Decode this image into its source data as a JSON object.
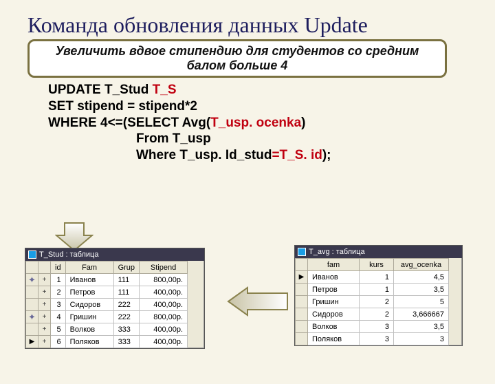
{
  "title": "Команда обновления данных Update",
  "callout": "Увеличить вдвое стипендию для студентов со средним балом больше 4",
  "sql": {
    "l1a": "UPDATE",
    "l1b": " T_Stud ",
    "l1c": " T_S",
    "l2a": "SET",
    "l2b": " stipend = stipend*2",
    "l3a": "WHERE",
    "l3b": " 4<=(",
    "l3c": "SELECT",
    "l3d": "  Avg(",
    "l3e": "T_usp. ocenka",
    "l3f": ")",
    "l4a": "From",
    "l4b": " T_usp",
    "l5a": "Where",
    "l5b": "  T_usp. Id_stud",
    "l5c": "=",
    "l5d": "T_S. id",
    "l5e": ");"
  },
  "left_table": {
    "caption": "T_Stud : таблица",
    "cols": [
      "id",
      "Fam",
      "Grup",
      "Stipend"
    ],
    "rows": [
      {
        "mark": "star",
        "id": "1",
        "fam": "Иванов",
        "grup": "111",
        "st": "800,00р."
      },
      {
        "mark": "plus",
        "id": "2",
        "fam": "Петров",
        "grup": "111",
        "st": "400,00р."
      },
      {
        "mark": "plus",
        "id": "3",
        "fam": "Сидоров",
        "grup": "222",
        "st": "400,00р."
      },
      {
        "mark": "star",
        "id": "4",
        "fam": "Гришин",
        "grup": "222",
        "st": "800,00р."
      },
      {
        "mark": "plus",
        "id": "5",
        "fam": "Волков",
        "grup": "333",
        "st": "400,00р."
      },
      {
        "mark": "cursor",
        "id": "6",
        "fam": "Поляков",
        "grup": "333",
        "st": "400,00р."
      }
    ]
  },
  "right_table": {
    "caption": "T_avg : таблица",
    "cols": [
      "fam",
      "kurs",
      "avg_ocenka"
    ],
    "rows": [
      {
        "mark": "cursor",
        "fam": "Иванов",
        "kurs": "1",
        "avg": "4,5"
      },
      {
        "mark": "",
        "fam": "Петров",
        "kurs": "1",
        "avg": "3,5"
      },
      {
        "mark": "",
        "fam": "Гришин",
        "kurs": "2",
        "avg": "5"
      },
      {
        "mark": "",
        "fam": "Сидоров",
        "kurs": "2",
        "avg": "3,666667"
      },
      {
        "mark": "",
        "fam": "Волков",
        "kurs": "3",
        "avg": "3,5"
      },
      {
        "mark": "",
        "fam": "Поляков",
        "kurs": "3",
        "avg": "3"
      }
    ]
  }
}
